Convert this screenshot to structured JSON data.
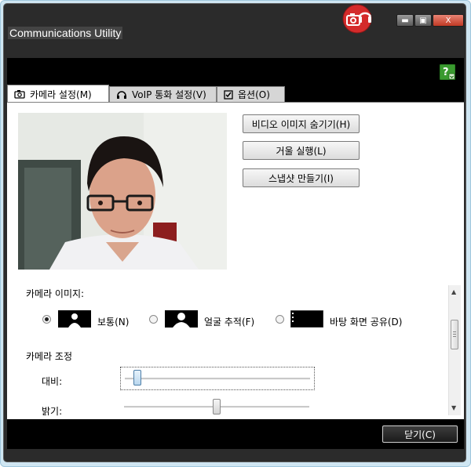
{
  "window": {
    "title": "Communications Utility"
  },
  "controls": {
    "minimize": "▬",
    "maximize": "▣",
    "close": "X"
  },
  "tabs": [
    {
      "label": "카메라 설정(M)"
    },
    {
      "label": "VoIP 통화 설정(V)"
    },
    {
      "label": "옵션(O)"
    }
  ],
  "buttons": {
    "hide_video": "비디오 이미지 숨기기(H)",
    "mirror": "거울 실행(L)",
    "snapshot": "스냅샷 만들기(I)",
    "close": "닫기(C)"
  },
  "camera_image": {
    "heading": "카메라 이미지:",
    "options": [
      {
        "label": "보통(N)",
        "selected": true
      },
      {
        "label": "얼굴 추적(F)",
        "selected": false
      },
      {
        "label": "바탕 화면 공유(D)",
        "selected": false
      }
    ]
  },
  "camera_adjust": {
    "heading": "카메라 조정",
    "contrast_label": "대비:",
    "contrast_value": 0.05,
    "brightness_label": "밝기:",
    "brightness_value": 0.5
  },
  "colors": {
    "accent_red": "#d42b2b",
    "help_green": "#3a9a2f"
  }
}
